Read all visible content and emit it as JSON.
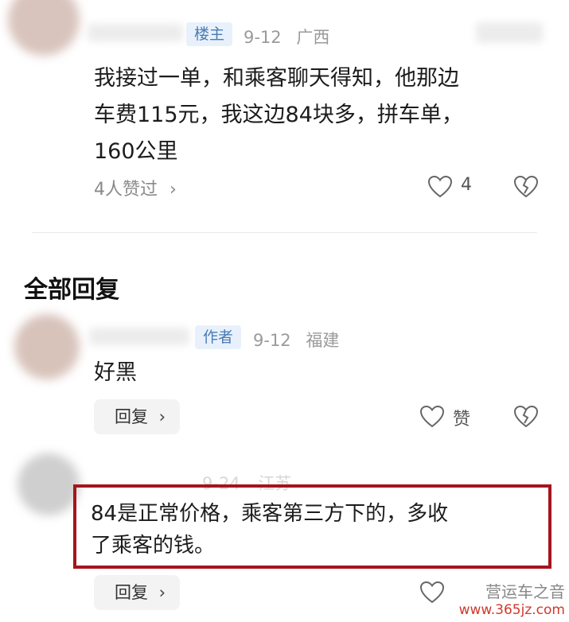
{
  "post": {
    "badge": "楼主",
    "date": "9-12",
    "location": "广西",
    "text_lines": [
      "我接过一单，和乘客聊天得知，他那边",
      "车费115元，我这边84块多，拼车单，",
      "160公里"
    ],
    "likers": "4人赞过",
    "like_count": "4"
  },
  "section": {
    "title": "全部回复"
  },
  "replies": [
    {
      "badge": "作者",
      "date": "9-12",
      "location": "福建",
      "text": "好黑",
      "reply_label": "回复",
      "like_label": "赞"
    },
    {
      "date": "9-24",
      "location": "江苏",
      "text_lines": [
        "84是正常价格，乘客第三方下的，多收",
        "了乘客的钱。"
      ],
      "reply_label": "回复"
    }
  ],
  "watermark": {
    "text": "营运车之音",
    "url": "www.365jz.com"
  },
  "colors": {
    "highlight": "#a5151d",
    "badge_bg": "#e8f1fb",
    "badge_text": "#4a7bb5"
  }
}
